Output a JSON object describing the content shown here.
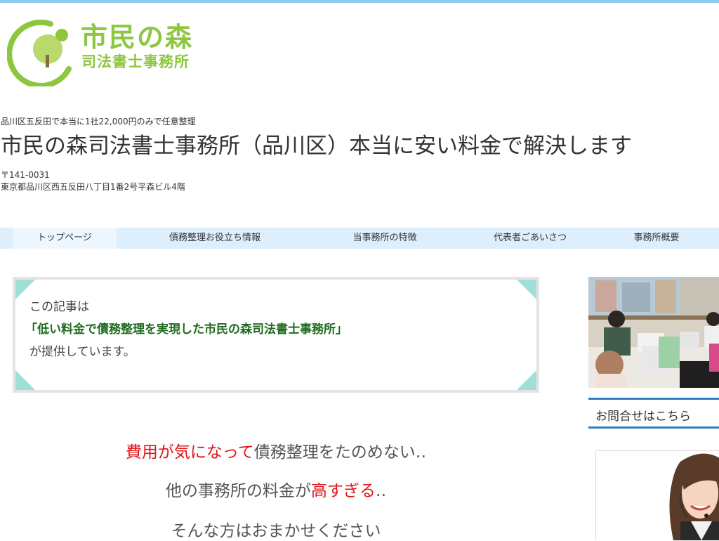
{
  "header": {
    "logo_name": "市民の森",
    "logo_sub": "司法書士事務所",
    "tagline": "品川区五反田で本当に1社22,000円のみで任意整理",
    "title": "市民の森司法書士事務所（品川区）本当に安い料金で解決します",
    "zip": "〒141-0031",
    "address": "東京都品川区西五反田八丁目1番2号平森ビル4階"
  },
  "nav": {
    "items": [
      {
        "label": "トップページ"
      },
      {
        "label": "債務整理お役立ち情報"
      },
      {
        "label": "当事務所の特徴"
      },
      {
        "label": "代表者ごあいさつ"
      },
      {
        "label": "事務所概要"
      }
    ]
  },
  "notice": {
    "line1": "この記事は",
    "line2": "「低い料金で債務整理を実現した市民の森司法書士事務所」",
    "line3": "が提供しています。"
  },
  "lead": {
    "line1_red": "費用が気になって",
    "line1_rest": "債務整理をたのめない‥",
    "line2_pre": "他の事務所の料金が",
    "line2_red": "高すぎる",
    "line2_post": "‥",
    "line3": "そんな方はおまかせください"
  },
  "sidebar": {
    "contact_heading": "お問合せはこちら"
  },
  "colors": {
    "brand_green": "#8dc63f",
    "nav_bg": "#ddeefc",
    "accent_red": "#e0161b",
    "notice_green": "#1f6b1f",
    "corner_teal": "#9ee0d6",
    "sidebar_rule": "#2f7fc1"
  },
  "icons": {
    "logo": "tree-logo-icon"
  }
}
